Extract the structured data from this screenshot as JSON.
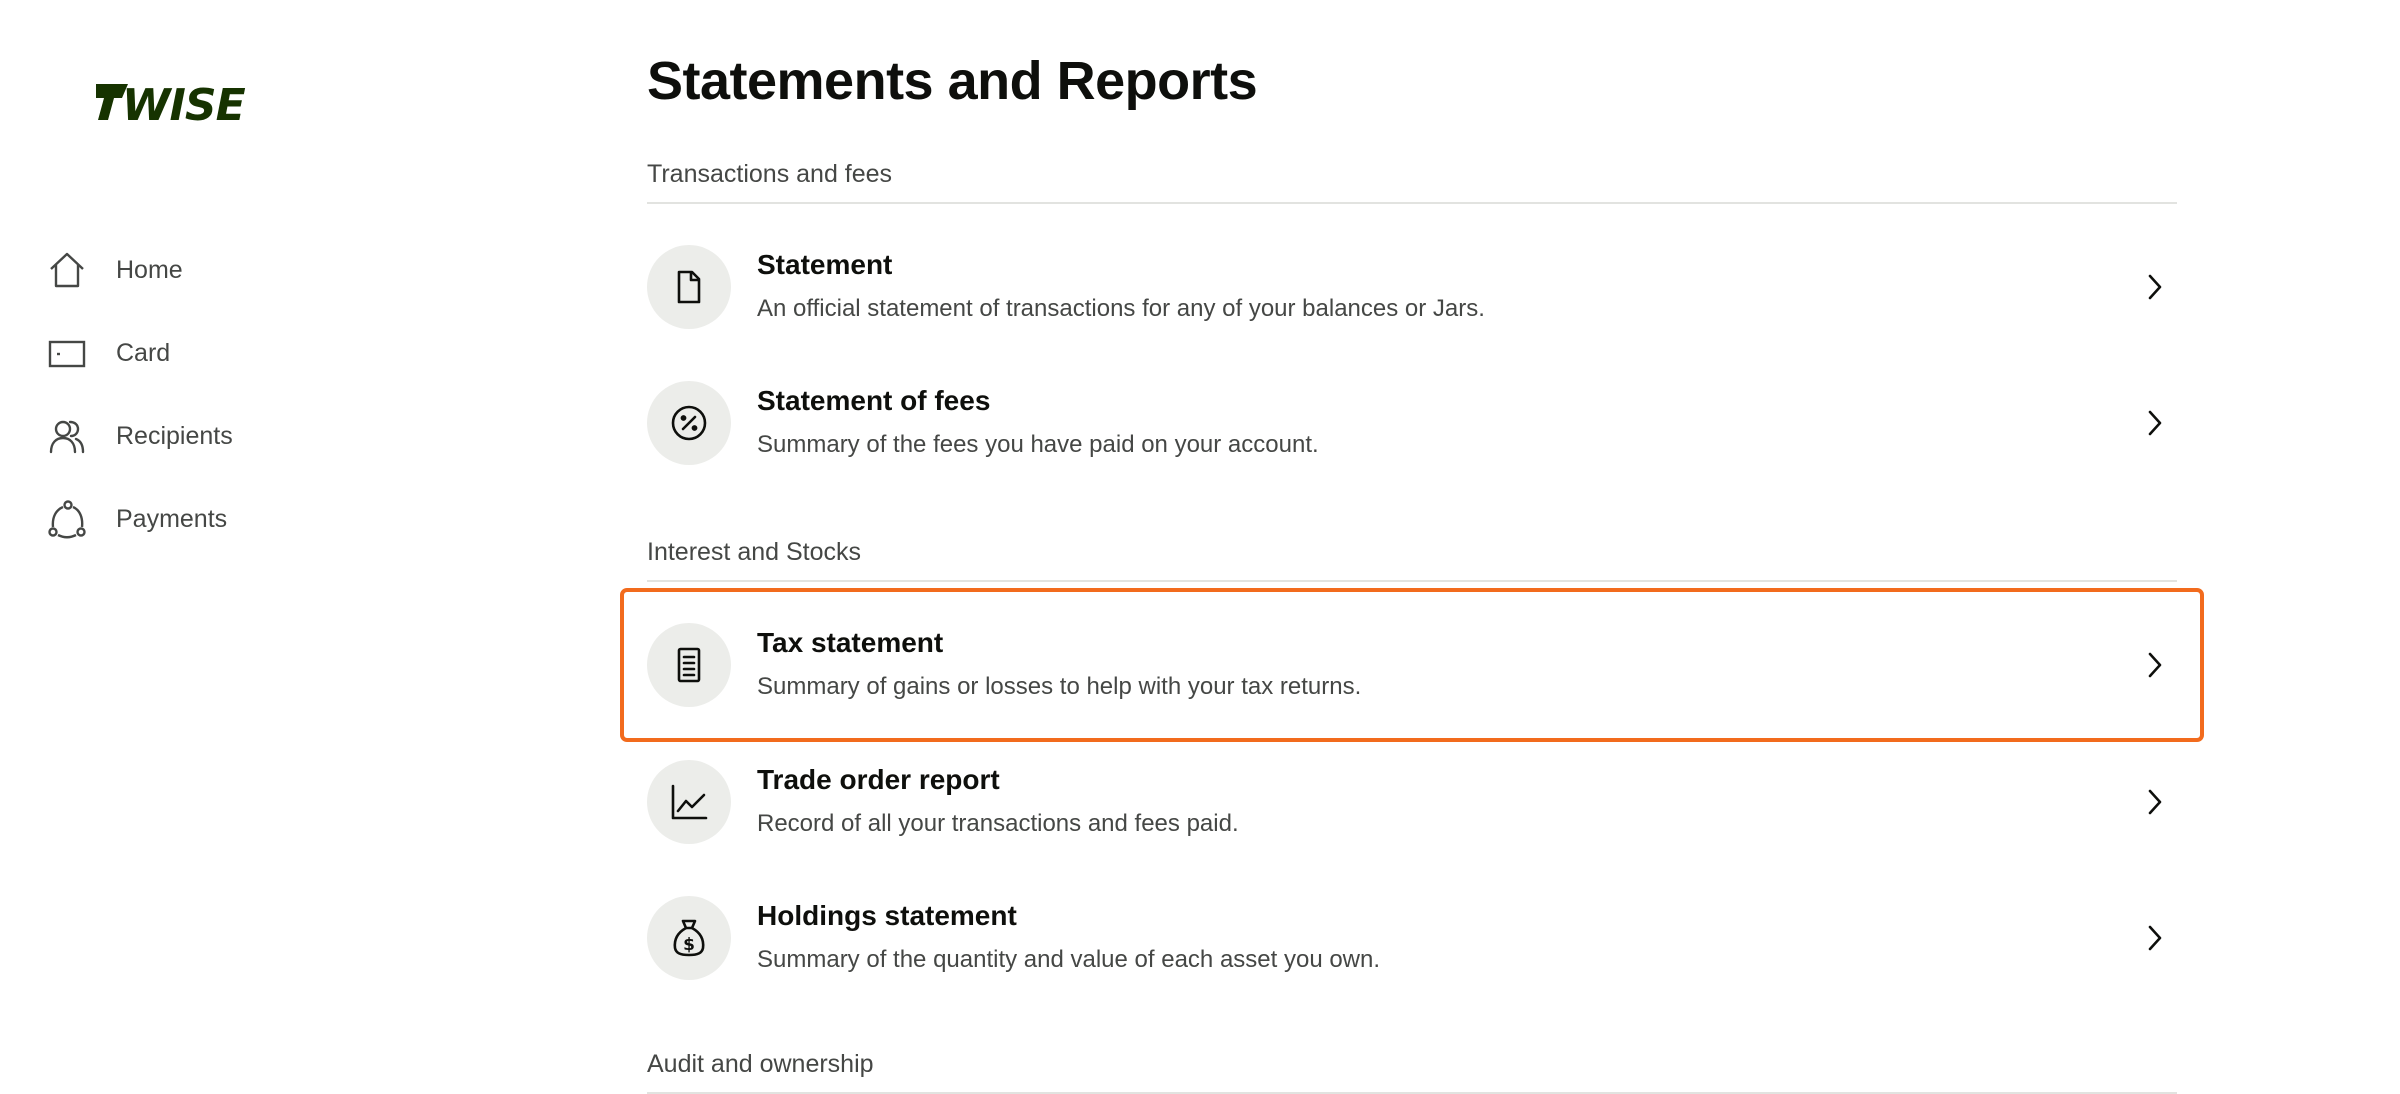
{
  "brand": {
    "logo_text": "WISE",
    "logo_color": "#163300"
  },
  "sidebar": {
    "items": [
      {
        "label": "Home",
        "icon": "home-icon"
      },
      {
        "label": "Card",
        "icon": "card-icon"
      },
      {
        "label": "Recipients",
        "icon": "recipients-icon"
      },
      {
        "label": "Payments",
        "icon": "payments-icon"
      }
    ]
  },
  "main": {
    "title": "Statements and Reports",
    "sections": [
      {
        "header": "Transactions and fees",
        "items": [
          {
            "title": "Statement",
            "description": "An official statement of transactions for any of your balances or Jars.",
            "icon": "document-icon"
          },
          {
            "title": "Statement of fees",
            "description": "Summary of the fees you have paid on your account.",
            "icon": "percent-icon"
          }
        ]
      },
      {
        "header": "Interest and Stocks",
        "items": [
          {
            "title": "Tax statement",
            "description": "Summary of gains or losses to help with your tax returns.",
            "icon": "receipt-icon",
            "highlighted": true
          },
          {
            "title": "Trade order report",
            "description": "Record of all your transactions and fees paid.",
            "icon": "line-chart-icon"
          },
          {
            "title": "Holdings statement",
            "description": "Summary of the quantity and value of each asset you own.",
            "icon": "money-bag-icon"
          }
        ]
      },
      {
        "header": "Audit and ownership",
        "items": []
      }
    ]
  },
  "colors": {
    "highlight": "#f26b1d",
    "icon_bg": "#ecedea",
    "text_primary": "#0e0f0c",
    "text_secondary": "#454745",
    "divider": "#e2e3e0"
  }
}
